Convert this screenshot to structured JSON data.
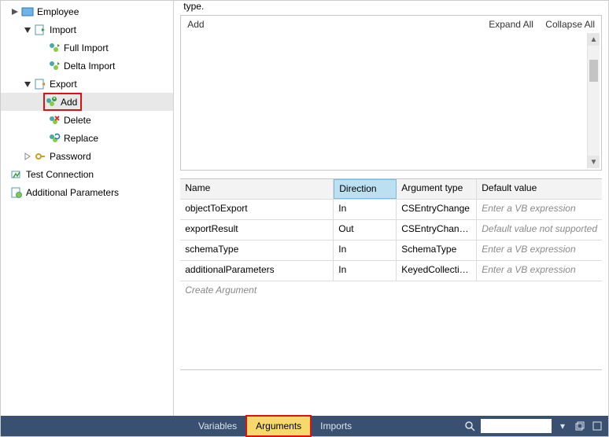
{
  "tree": {
    "root": "Employee",
    "import": {
      "label": "Import",
      "full": "Full Import",
      "delta": "Delta Import"
    },
    "export": {
      "label": "Export",
      "add": "Add",
      "delete": "Delete",
      "replace": "Replace"
    },
    "password": "Password",
    "test_connection": "Test Connection",
    "additional_parameters": "Additional Parameters"
  },
  "surface": {
    "truncated_caption": "type.",
    "add_label": "Add",
    "expand_all": "Expand All",
    "collapse_all": "Collapse All"
  },
  "grid": {
    "headers": {
      "name": "Name",
      "direction": "Direction",
      "arg_type": "Argument type",
      "default": "Default value"
    },
    "rows": [
      {
        "name": "objectToExport",
        "direction": "In",
        "type": "CSEntryChange",
        "default": "Enter a VB expression",
        "default_is_placeholder": true
      },
      {
        "name": "exportResult",
        "direction": "Out",
        "type": "CSEntryChangeResult",
        "default": "Default value not supported",
        "default_is_placeholder": true
      },
      {
        "name": "schemaType",
        "direction": "In",
        "type": "SchemaType",
        "default": "Enter a VB expression",
        "default_is_placeholder": true
      },
      {
        "name": "additionalParameters",
        "direction": "In",
        "type": "KeyedCollection<String, ConfigParameter>",
        "default": "Enter a VB expression",
        "default_is_placeholder": true
      }
    ],
    "create_hint": "Create Argument"
  },
  "bottom": {
    "variables": "Variables",
    "arguments": "Arguments",
    "imports": "Imports",
    "search_placeholder": ""
  }
}
